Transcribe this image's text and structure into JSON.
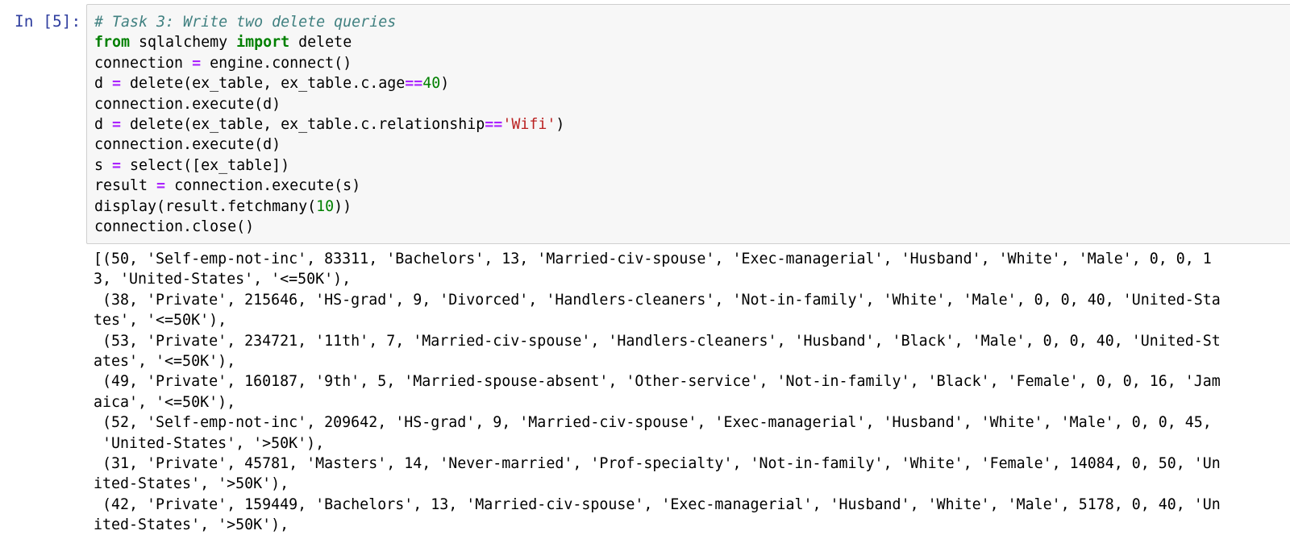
{
  "cell": {
    "prompt": "In [5]:",
    "input_lines": [
      [
        {
          "t": "# Task 3: Write two delete queries",
          "c": "comment"
        }
      ],
      [
        {
          "t": "from",
          "c": "keyword"
        },
        {
          "t": " sqlalchemy ",
          "c": ""
        },
        {
          "t": "import",
          "c": "keyword"
        },
        {
          "t": " delete",
          "c": ""
        }
      ],
      [
        {
          "t": "connection ",
          "c": ""
        },
        {
          "t": "=",
          "c": "op"
        },
        {
          "t": " engine.connect()",
          "c": ""
        }
      ],
      [
        {
          "t": "d ",
          "c": ""
        },
        {
          "t": "=",
          "c": "op"
        },
        {
          "t": " delete(ex_table, ex_table.c.age",
          "c": ""
        },
        {
          "t": "==",
          "c": "op"
        },
        {
          "t": "40",
          "c": "num"
        },
        {
          "t": ")",
          "c": ""
        }
      ],
      [
        {
          "t": "connection.execute(d)",
          "c": ""
        }
      ],
      [
        {
          "t": "d ",
          "c": ""
        },
        {
          "t": "=",
          "c": "op"
        },
        {
          "t": " delete(ex_table, ex_table.c.relationship",
          "c": ""
        },
        {
          "t": "==",
          "c": "op"
        },
        {
          "t": "'Wifi'",
          "c": "str"
        },
        {
          "t": ")",
          "c": ""
        }
      ],
      [
        {
          "t": "connection.execute(d)",
          "c": ""
        }
      ],
      [
        {
          "t": "s ",
          "c": ""
        },
        {
          "t": "=",
          "c": "op"
        },
        {
          "t": " select([ex_table])",
          "c": ""
        }
      ],
      [
        {
          "t": "result ",
          "c": ""
        },
        {
          "t": "=",
          "c": "op"
        },
        {
          "t": " connection.execute(s)",
          "c": ""
        }
      ],
      [
        {
          "t": "display(result.fetchmany(",
          "c": ""
        },
        {
          "t": "10",
          "c": "num"
        },
        {
          "t": "))",
          "c": ""
        }
      ],
      [
        {
          "t": "connection.close()",
          "c": ""
        }
      ]
    ],
    "output_lines": [
      "[(50, 'Self-emp-not-inc', 83311, 'Bachelors', 13, 'Married-civ-spouse', 'Exec-managerial', 'Husband', 'White', 'Male', 0, 0, 1",
      "3, 'United-States', '<=50K'),",
      " (38, 'Private', 215646, 'HS-grad', 9, 'Divorced', 'Handlers-cleaners', 'Not-in-family', 'White', 'Male', 0, 0, 40, 'United-Sta",
      "tes', '<=50K'),",
      " (53, 'Private', 234721, '11th', 7, 'Married-civ-spouse', 'Handlers-cleaners', 'Husband', 'Black', 'Male', 0, 0, 40, 'United-St",
      "ates', '<=50K'),",
      " (49, 'Private', 160187, '9th', 5, 'Married-spouse-absent', 'Other-service', 'Not-in-family', 'Black', 'Female', 0, 0, 16, 'Jam",
      "aica', '<=50K'),",
      " (52, 'Self-emp-not-inc', 209642, 'HS-grad', 9, 'Married-civ-spouse', 'Exec-managerial', 'Husband', 'White', 'Male', 0, 0, 45,",
      " 'United-States', '>50K'),",
      " (31, 'Private', 45781, 'Masters', 14, 'Never-married', 'Prof-specialty', 'Not-in-family', 'White', 'Female', 14084, 0, 50, 'Un",
      "ited-States', '>50K'),",
      " (42, 'Private', 159449, 'Bachelors', 13, 'Married-civ-spouse', 'Exec-managerial', 'Husband', 'White', 'Male', 5178, 0, 40, 'Un",
      "ited-States', '>50K'),"
    ]
  },
  "colors": {
    "prompt": "#303f9f",
    "input_background": "#f7f7f7",
    "input_border": "#cfcfcf",
    "comment": "#408080",
    "keyword": "#008000",
    "operator": "#aa22ff",
    "number": "#008000",
    "string": "#ba2121"
  }
}
